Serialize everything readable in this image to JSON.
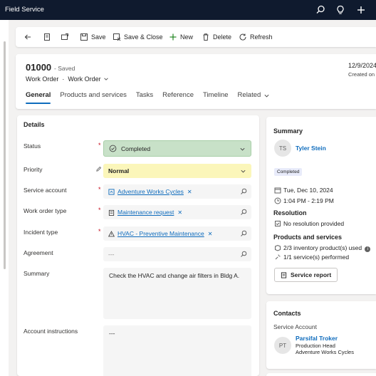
{
  "app": {
    "title": "Field Service"
  },
  "commands": {
    "save": "Save",
    "save_close": "Save & Close",
    "new": "New",
    "delete": "Delete",
    "refresh": "Refresh"
  },
  "header": {
    "record_number": "01000",
    "saved_status": "- Saved",
    "entity": "Work Order",
    "form_selector": "Work Order",
    "date": "12/9/2024",
    "created_label": "Created on"
  },
  "tabs": [
    "General",
    "Products and services",
    "Tasks",
    "Reference",
    "Timeline",
    "Related"
  ],
  "details": {
    "section_title": "Details",
    "fields": {
      "status": {
        "label": "Status",
        "value": "Completed"
      },
      "priority": {
        "label": "Priority",
        "value": "Normal"
      },
      "service_account": {
        "label": "Service account",
        "value": "Adventure Works Cycles"
      },
      "work_order_type": {
        "label": "Work order type",
        "value": "Maintenance request"
      },
      "incident_type": {
        "label": "Incident type",
        "value": "HVAC - Preventive Maintenance"
      },
      "agreement": {
        "label": "Agreement",
        "value": "---"
      },
      "summary": {
        "label": "Summary",
        "value": "Check the HVAC and change air filters in Bldg A."
      },
      "account_instructions": {
        "label": "Account instructions",
        "value": "---"
      }
    }
  },
  "summary_card": {
    "title": "Summary",
    "assignee_initials": "TS",
    "assignee": "Tyler Stein",
    "status_badge": "Completed",
    "date": "Tue, Dec 10, 2024",
    "time": "1:04 PM - 2:19 PM",
    "resolution_title": "Resolution",
    "resolution_value": "No resolution provided",
    "products_title": "Products and services",
    "inventory": "2/3 inventory product(s) used",
    "services": "1/1 service(s) performed",
    "report_button": "Service report"
  },
  "contacts_card": {
    "title": "Contacts",
    "service_account_label": "Service Account",
    "contact_initials": "PT",
    "contact_name": "Parsifal Troker",
    "contact_role": "Production Head",
    "contact_company": "Adventure Works Cycles"
  },
  "colors": {
    "topbar": "#0f1a2e",
    "status_completed": "#c8e1c8",
    "priority_normal": "#fbf6ba",
    "link": "#0f6cbd"
  }
}
